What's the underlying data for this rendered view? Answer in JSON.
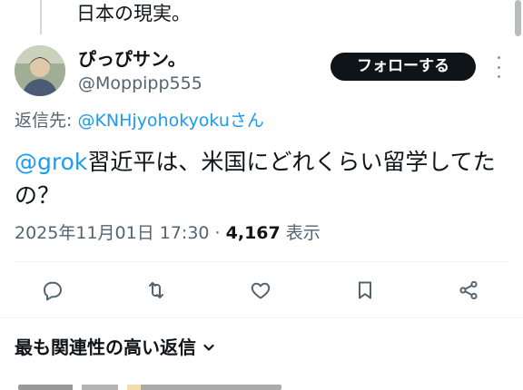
{
  "previous_post": {
    "text": "日本の現実。"
  },
  "post": {
    "display_name": "ぴっぴサン。",
    "handle": "@Moppipp555",
    "follow_label": "フォローする",
    "reply_prefix": "返信先: ",
    "reply_to": "@KNHjyohokyokuさん",
    "mention": "@grok",
    "body": "習近平は、米国にどれくらい留学してたの？",
    "timestamp": "2025年11月01日 17:30",
    "separator": " · ",
    "views_count": "4,167",
    "views_label": " 表示"
  },
  "actions": [
    {
      "name": "reply",
      "icon": "reply-icon"
    },
    {
      "name": "repost",
      "icon": "repost-icon"
    },
    {
      "name": "like",
      "icon": "heart-icon"
    },
    {
      "name": "bookmark",
      "icon": "bookmark-icon"
    },
    {
      "name": "share",
      "icon": "share-icon"
    }
  ],
  "replies_sort": {
    "label": "最も関連性の高い返信"
  },
  "colors": {
    "link": "#1d9bf0",
    "text": "#0f1419",
    "muted": "#536471",
    "button_bg": "#0f1419"
  }
}
